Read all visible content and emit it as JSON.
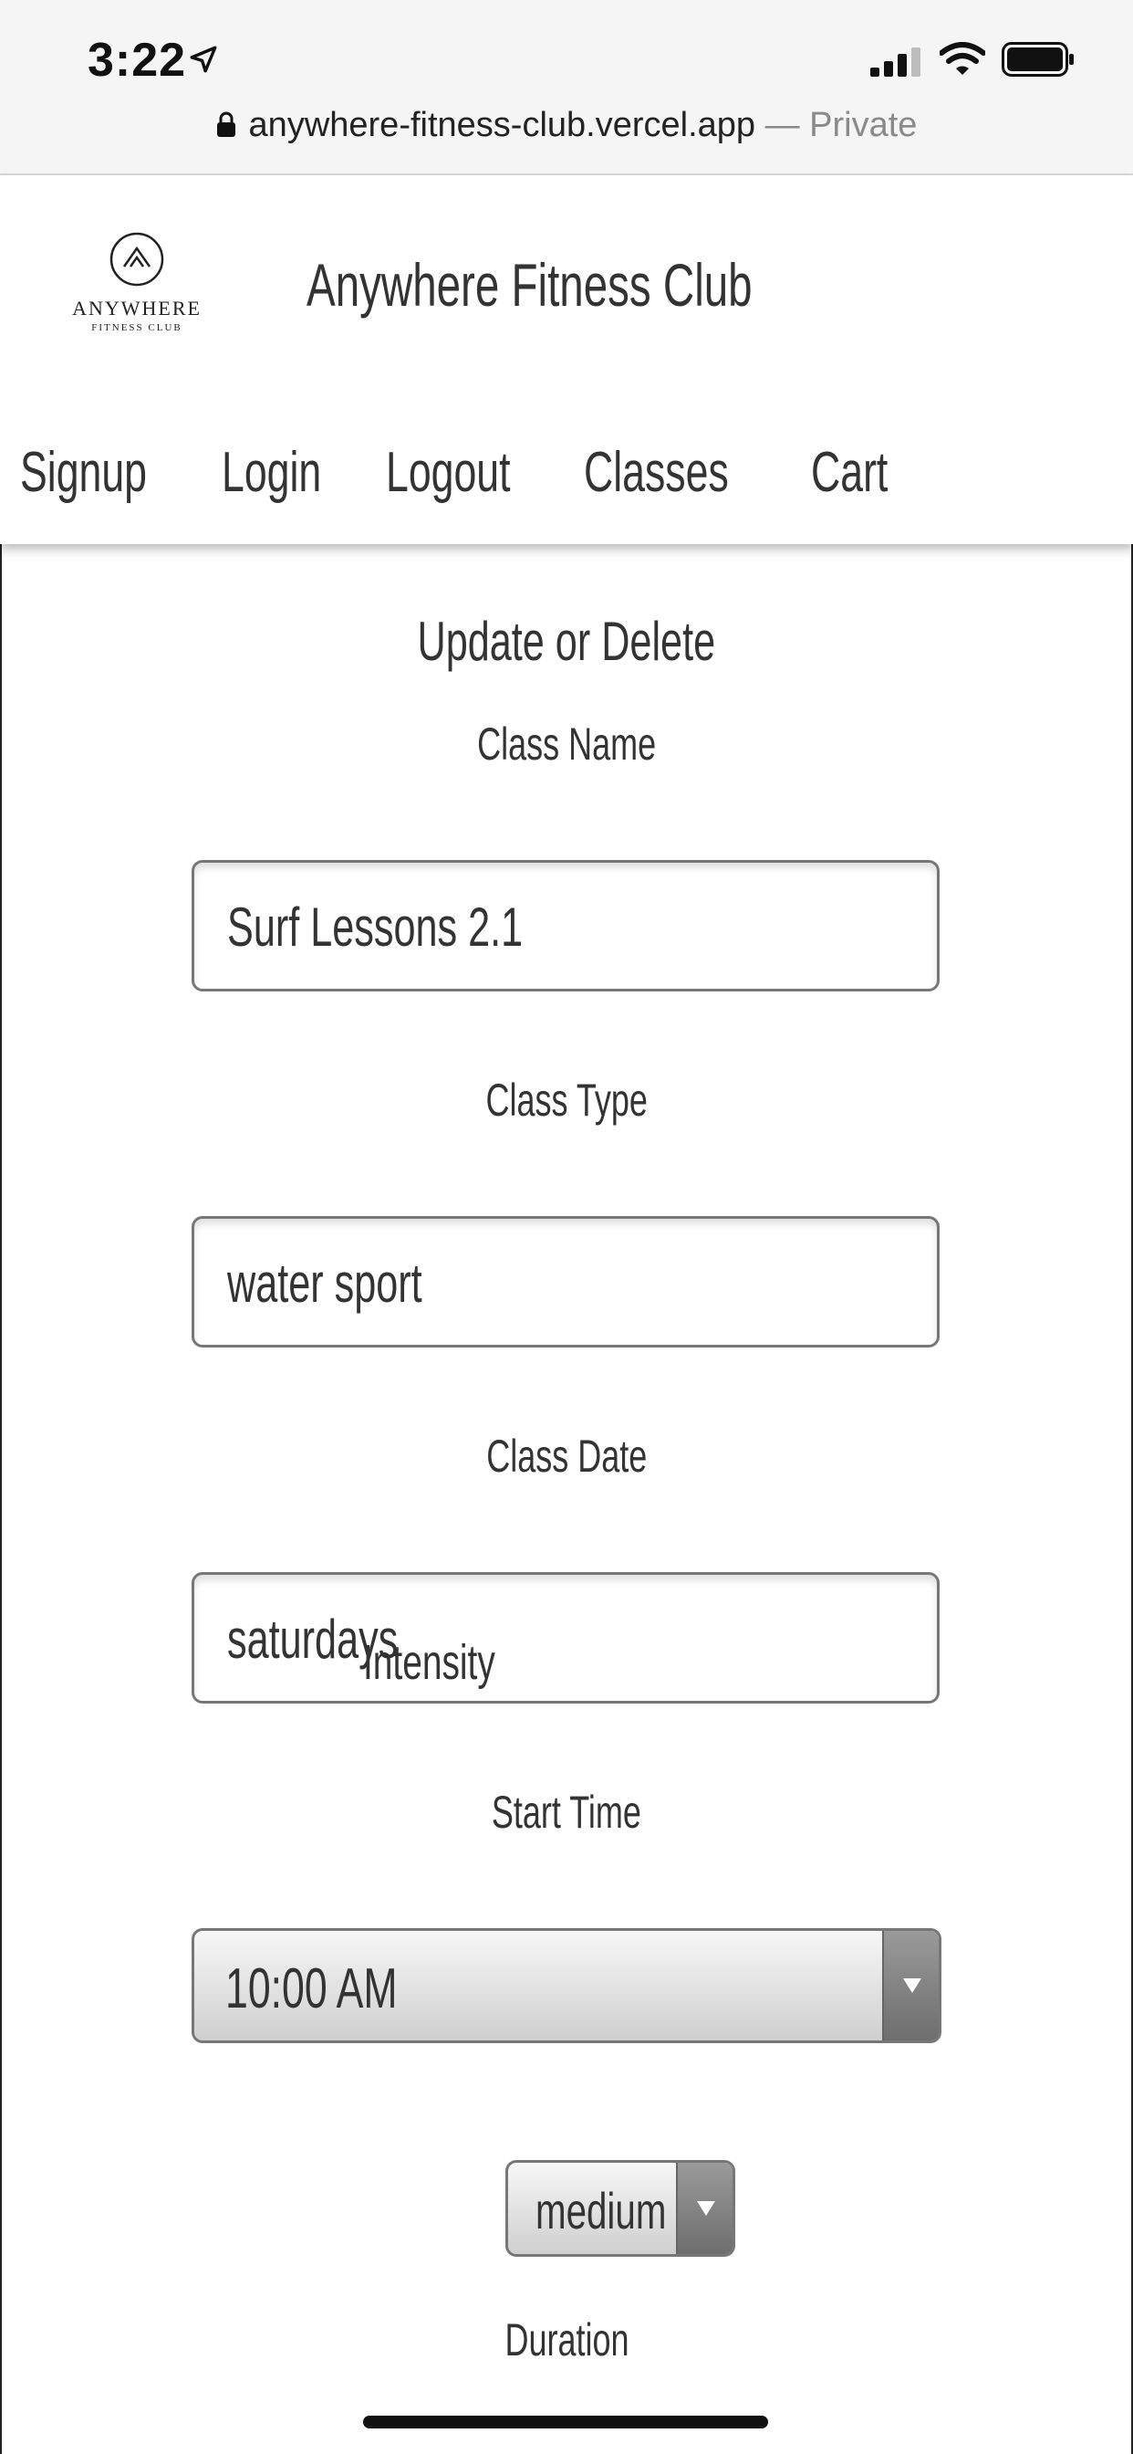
{
  "status_bar": {
    "time": "3:22",
    "url": "anywhere-fitness-club.vercel.app",
    "privacy": "— Private",
    "icons": [
      "location-arrow-icon",
      "cellular-signal-icon",
      "wifi-icon",
      "battery-icon",
      "lock-icon"
    ]
  },
  "header": {
    "logo_word": "ANYWHERE",
    "logo_sub": "FITNESS CLUB",
    "site_title": "Anywhere Fitness Club",
    "nav": [
      "Signup",
      "Login",
      "Logout",
      "Classes",
      "Cart"
    ]
  },
  "form": {
    "title": "Update or Delete",
    "class_name": {
      "label": "Class Name",
      "value": "Surf Lessons 2.1"
    },
    "class_type": {
      "label": "Class Type",
      "value": "water sport"
    },
    "class_date": {
      "label": "Class Date",
      "value": "saturdays"
    },
    "start_time": {
      "label": "Start Time",
      "value": "10:00 AM"
    },
    "intensity": {
      "label": "Intensity",
      "value": "medium"
    },
    "duration": {
      "label": "Duration"
    }
  }
}
